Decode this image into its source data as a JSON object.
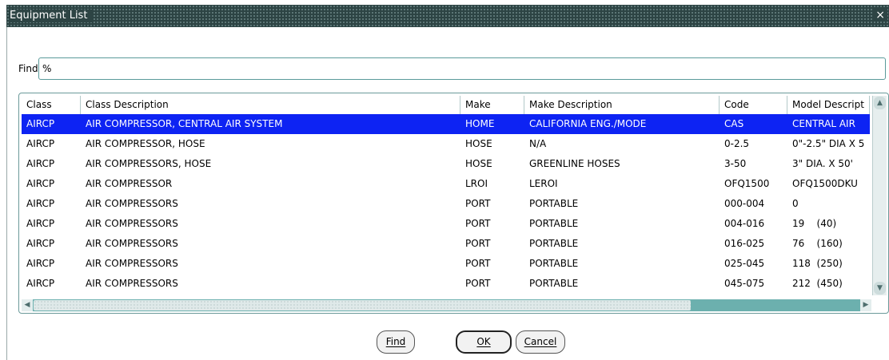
{
  "window": {
    "title": "Equipment List",
    "close_glyph": "×"
  },
  "search": {
    "label": "Find",
    "value": "%"
  },
  "table": {
    "columns": [
      "Class",
      "Class Description",
      "Make",
      "Make Description",
      "Code",
      "Model Descript"
    ],
    "rows": [
      [
        "AIRCP",
        "AIR COMPRESSOR, CENTRAL AIR SYSTEM",
        "HOME",
        "CALIFORNIA ENG./MODE",
        "CAS",
        "CENTRAL AIR"
      ],
      [
        "AIRCP",
        "AIR COMPRESSOR, HOSE",
        "HOSE",
        "N/A",
        "0-2.5",
        "0\"-2.5\" DIA X 5"
      ],
      [
        "AIRCP",
        "AIR COMPRESSORS, HOSE",
        "HOSE",
        "GREENLINE HOSES",
        "3-50",
        "3\" DIA. X 50'"
      ],
      [
        "AIRCP",
        "AIR COMPRESSOR",
        "LROI",
        "LEROI",
        "OFQ1500",
        "OFQ1500DKU"
      ],
      [
        "AIRCP",
        "AIR COMPRESSORS",
        "PORT",
        "PORTABLE",
        "000-004",
        "0"
      ],
      [
        "AIRCP",
        "AIR COMPRESSORS",
        "PORT",
        "PORTABLE",
        "004-016",
        "19    (40)"
      ],
      [
        "AIRCP",
        "AIR COMPRESSORS",
        "PORT",
        "PORTABLE",
        "016-025",
        "76    (160)"
      ],
      [
        "AIRCP",
        "AIR COMPRESSORS",
        "PORT",
        "PORTABLE",
        "025-045",
        "118  (250)"
      ],
      [
        "AIRCP",
        "AIR COMPRESSORS",
        "PORT",
        "PORTABLE",
        "045-075",
        "212  (450)"
      ]
    ],
    "selected_row": 0
  },
  "buttons": {
    "find": "Find",
    "ok": "OK",
    "cancel": "Cancel"
  },
  "colors": {
    "title_bar": "#2d4444",
    "selection": "#0d23f3",
    "scroll_track": "#6cb0ae"
  }
}
